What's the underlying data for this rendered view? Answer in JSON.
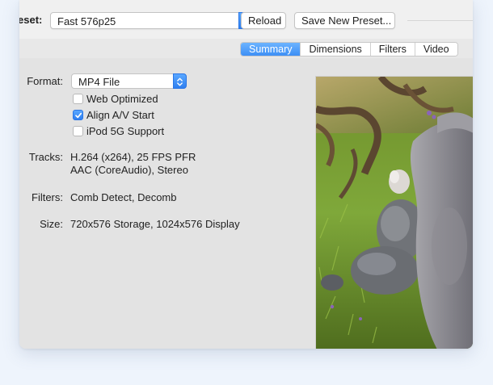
{
  "toolbar": {
    "preset_label": "eset:",
    "preset_value": "Fast 576p25",
    "reload_label": "Reload",
    "save_preset_label": "Save New Preset..."
  },
  "tabs": [
    {
      "label": "Summary",
      "active": true
    },
    {
      "label": "Dimensions",
      "active": false
    },
    {
      "label": "Filters",
      "active": false
    },
    {
      "label": "Video",
      "active": false
    }
  ],
  "summary": {
    "format_label": "Format:",
    "format_value": "MP4 File",
    "options": [
      {
        "label": "Web Optimized",
        "checked": false
      },
      {
        "label": "Align A/V Start",
        "checked": true
      },
      {
        "label": "iPod 5G Support",
        "checked": false
      }
    ],
    "tracks_label": "Tracks:",
    "tracks_line1": "H.264 (x264), 25 FPS PFR",
    "tracks_line2": "AAC (CoreAudio), Stereo",
    "filters_label": "Filters:",
    "filters_value": "Comb Detect, Decomb",
    "size_label": "Size:",
    "size_value": "720x576 Storage, 1024x576 Display"
  },
  "colors": {
    "accent": "#3d8ff5",
    "background": "#eef4fc"
  }
}
